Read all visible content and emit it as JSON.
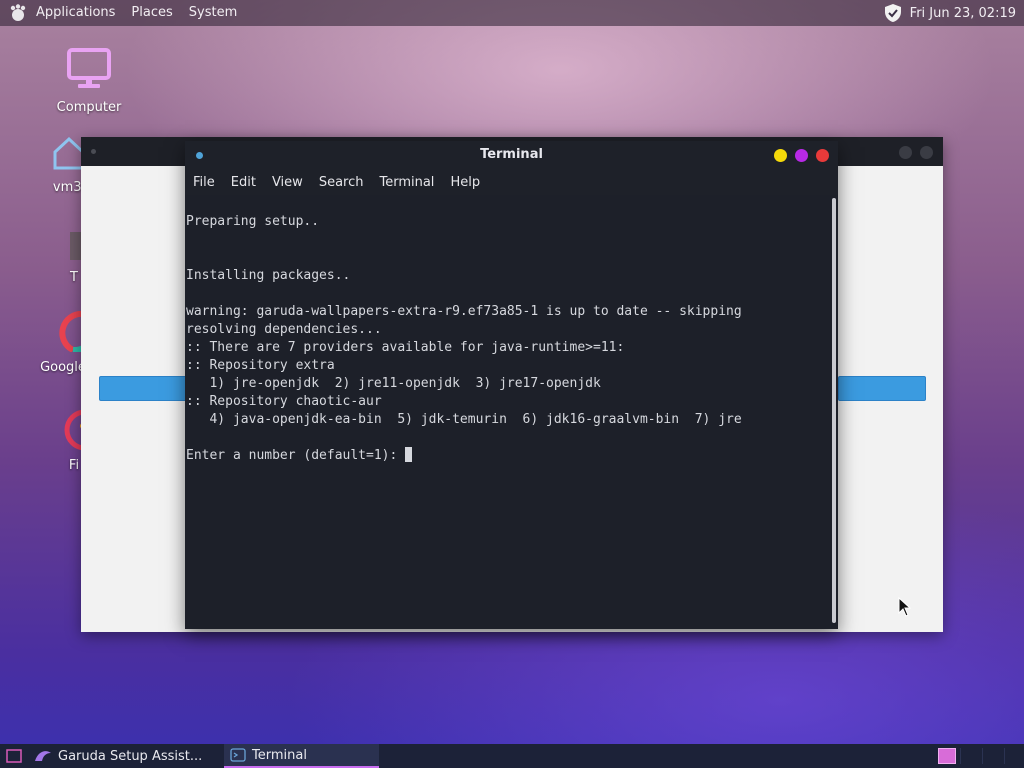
{
  "top_panel": {
    "menus": [
      "Applications",
      "Places",
      "System"
    ],
    "clock": "Fri Jun 23, 02:19",
    "icons": {
      "logo": "garuda-logo-icon",
      "shield": "shield-check-icon"
    }
  },
  "desktop": {
    "icons": [
      {
        "label": "Computer",
        "icon": "computer-icon"
      },
      {
        "label": "vm3'",
        "icon": "home-icon"
      },
      {
        "label": "T",
        "icon": "trash-icon"
      },
      {
        "label": "Google",
        "icon": "chrome-icon"
      },
      {
        "label": "Fi",
        "icon": "firefox-icon"
      }
    ]
  },
  "terminal": {
    "title": "Terminal",
    "menus": [
      "File",
      "Edit",
      "View",
      "Search",
      "Terminal",
      "Help"
    ],
    "lines": [
      "",
      "Preparing setup..",
      "",
      "",
      "Installing packages..",
      "",
      "warning: garuda-wallpapers-extra-r9.ef73a85-1 is up to date -- skipping",
      "resolving dependencies...",
      ":: There are 7 providers available for java-runtime>=11:",
      ":: Repository extra",
      "   1) jre-openjdk  2) jre11-openjdk  3) jre17-openjdk",
      ":: Repository chaotic-aur",
      "   4) java-openjdk-ea-bin  5) jdk-temurin  6) jdk16-graalvm-bin  7) jre",
      "",
      "Enter a number (default=1): "
    ],
    "colors": {
      "minimize": "#f5d90a",
      "maximize": "#b829e6",
      "close": "#e83a3a"
    }
  },
  "taskbar": {
    "tasks": [
      {
        "label": "Garuda Setup Assist...",
        "icon": "garuda-icon"
      },
      {
        "label": "Terminal",
        "icon": "terminal-icon",
        "active": true
      }
    ]
  }
}
